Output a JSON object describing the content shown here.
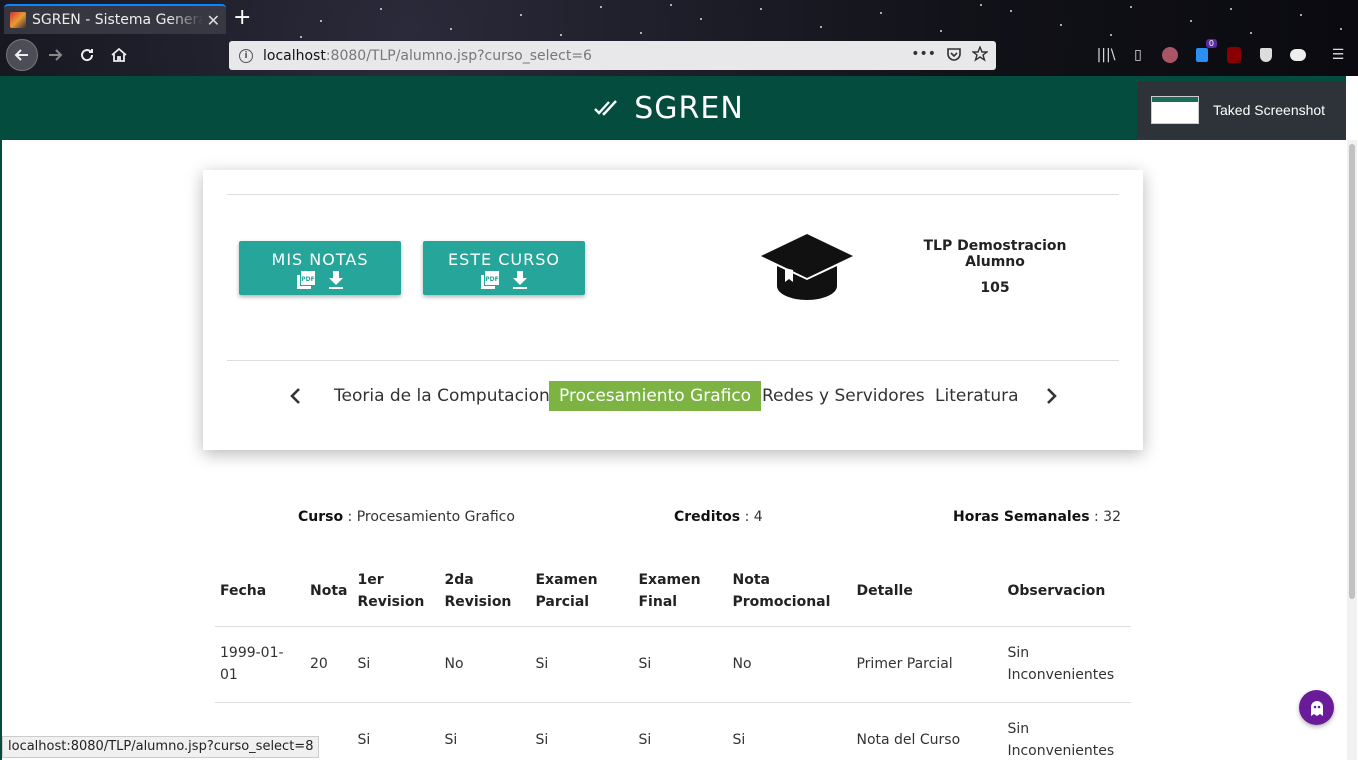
{
  "browser": {
    "tab_title": "SGREN - Sistema Generador de Reportes de Notas",
    "url_host": "localhost",
    "url_rest": ":8080/TLP/alumno.jsp?curso_select=6",
    "status_url": "localhost:8080/TLP/alumno.jsp?curso_select=8",
    "badge_count": "0",
    "icons": [
      "back-icon",
      "forward-icon",
      "reload-icon",
      "home-icon",
      "info-icon",
      "more-icon",
      "pocket-icon",
      "bookmark-star-icon",
      "library-icon",
      "sidebar-icon",
      "profile-icon",
      "ext-icon",
      "ublock-icon",
      "shield-icon",
      "ext2-icon",
      "menu-icon"
    ]
  },
  "header": {
    "brand": "SGREN",
    "bg_color": "#034c3e",
    "screenshot_popup": "Taked Screenshot"
  },
  "card": {
    "btn_mis_notas": "MIS NOTAS",
    "btn_este_curso": "ESTE CURSO",
    "student_name": "TLP Demostracion Alumno",
    "student_id": "105",
    "courses": [
      {
        "label": "Teoria de la Computacion",
        "active": false
      },
      {
        "label": "Procesamiento Grafico",
        "active": true
      },
      {
        "label": "Redes y Servidores",
        "active": false
      },
      {
        "label": "Literatura",
        "active": false
      }
    ],
    "button_color": "#26a69a",
    "active_tab_color": "#7cb342"
  },
  "course_info": {
    "curso_label": "Curso",
    "curso_value": " : Procesamiento Grafico",
    "creditos_label": "Creditos",
    "creditos_value": " : 4",
    "horas_label": "Horas Semanales",
    "horas_value": " : 32"
  },
  "table": {
    "headers": [
      "Fecha",
      "Nota",
      "1er Revision",
      "2da Revision",
      "Examen Parcial",
      "Examen Final",
      "Nota Promocional",
      "Detalle",
      "Observacion"
    ],
    "rows": [
      [
        "1999-01-01",
        "20",
        "Si",
        "No",
        "Si",
        "Si",
        "No",
        "Primer Parcial",
        "Sin Inconvenientes"
      ],
      [
        "",
        "",
        "Si",
        "Si",
        "Si",
        "Si",
        "Si",
        "Nota del Curso",
        "Sin Inconvenientes"
      ]
    ]
  }
}
